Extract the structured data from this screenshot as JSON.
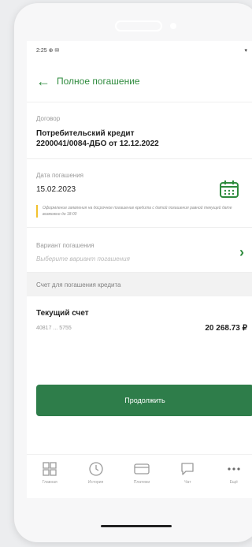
{
  "status_bar": {
    "time": "2:25",
    "icons": "⊕ ✉",
    "signal": "▾"
  },
  "header": {
    "title": "Полное погашение",
    "back_icon": "arrow-left-icon"
  },
  "contract": {
    "label": "Договор",
    "line1": "Потребительский кредит",
    "line2": "2200041/0084-ДБО от 12.12.2022"
  },
  "repayment_date": {
    "label": "Дата погашения",
    "value": "15.02.2023",
    "note": "Оформление заявления на досрочное погашение кредита с датой погашения равной текущей дате возможно до 18:00"
  },
  "variant": {
    "label": "Вариант погашения",
    "placeholder": "Выберите вариант погашения"
  },
  "account_section": {
    "title": "Счет для погашения кредита",
    "account_name": "Текущий счет",
    "account_number": "40817 ... 5755",
    "balance": "20 268.73 ₽"
  },
  "continue_label": "Продолжить",
  "tabs": [
    {
      "label": "Главная",
      "icon": "grid-icon"
    },
    {
      "label": "История",
      "icon": "clock-icon"
    },
    {
      "label": "Платежи",
      "icon": "card-icon"
    },
    {
      "label": "Чат",
      "icon": "chat-icon"
    },
    {
      "label": "Ещё",
      "icon": "more-icon"
    }
  ],
  "colors": {
    "accent": "#2e8b3d",
    "button": "#2e7d4a",
    "note_bar": "#f2c12e"
  }
}
